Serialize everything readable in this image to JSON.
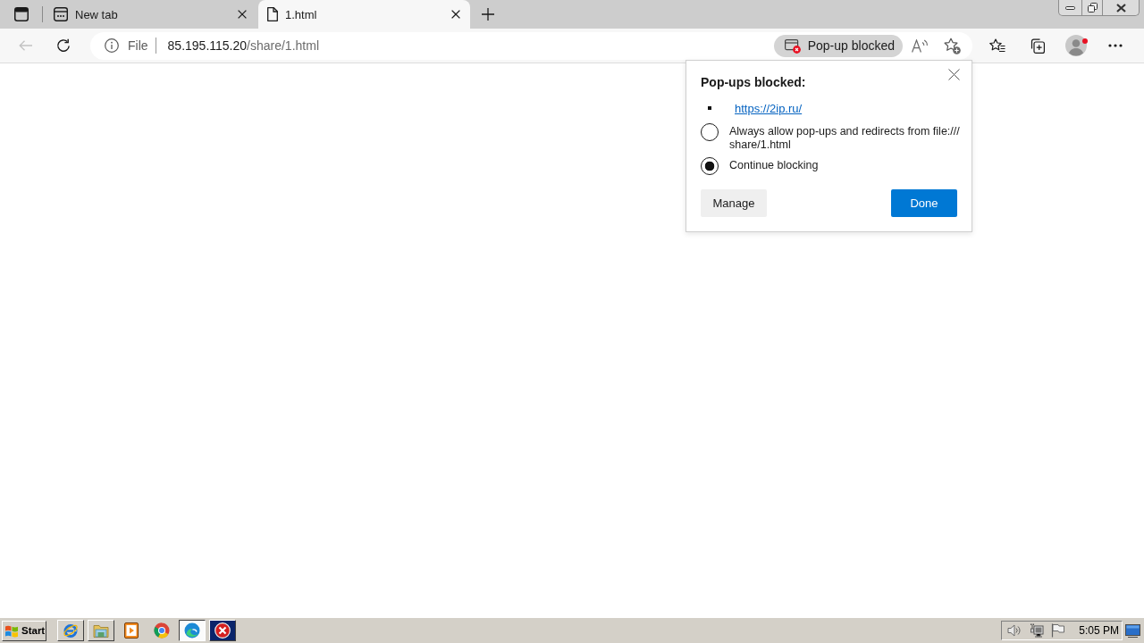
{
  "tabs": [
    {
      "kind": "newtab",
      "title": "New tab",
      "selected": false
    },
    {
      "kind": "file",
      "title": "1.html",
      "selected": true
    }
  ],
  "toolbar": {
    "back": {
      "disabled": true
    }
  },
  "address_bar": {
    "scheme": "File",
    "host": "85.195.115.20",
    "path": "/share/1.html",
    "popup_indicator": "Pop-up blocked"
  },
  "popup": {
    "title": "Pop-ups blocked:",
    "blocked": [
      "https://2ip.ru/"
    ],
    "options": [
      {
        "label": "Always allow pop-ups and redirects from file:///\nshare/1.html",
        "selected": false
      },
      {
        "label": "Continue blocking",
        "selected": true
      }
    ],
    "buttons": [
      {
        "label": "Manage",
        "kind": "secondary"
      },
      {
        "label": "Done",
        "kind": "primary"
      }
    ]
  },
  "taskbar": {
    "start": "Start",
    "apps": [
      {
        "kind": "ie",
        "running": true,
        "selected": false,
        "flashing": false
      },
      {
        "kind": "explorer",
        "running": true,
        "selected": false,
        "flashing": false
      },
      {
        "kind": "media",
        "running": false,
        "selected": false,
        "flashing": false
      },
      {
        "kind": "chrome",
        "running": false,
        "selected": false,
        "flashing": false
      },
      {
        "kind": "edge",
        "running": true,
        "selected": true,
        "flashing": false
      },
      {
        "kind": "error",
        "running": true,
        "selected": false,
        "flashing": true
      }
    ],
    "clock": "5:05 PM"
  }
}
